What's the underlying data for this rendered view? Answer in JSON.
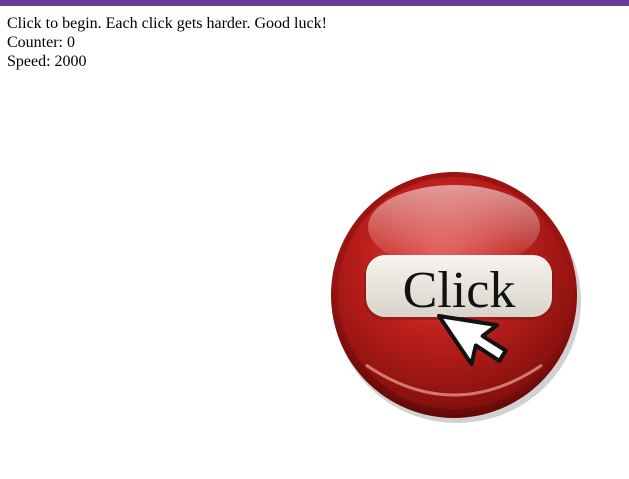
{
  "colors": {
    "top_bar": "#6a3d96",
    "button_red": "#c0201c",
    "button_dark_red": "#7d0e0c",
    "label_plate": "#e6e3dc"
  },
  "game": {
    "instructions": "Click to begin. Each click gets harder. Good luck!",
    "counter_label": "Counter:",
    "counter_value": "0",
    "speed_label": "Speed:",
    "speed_value": "2000"
  },
  "click_button": {
    "label": "Click",
    "icon": "cursor-arrow-icon"
  }
}
